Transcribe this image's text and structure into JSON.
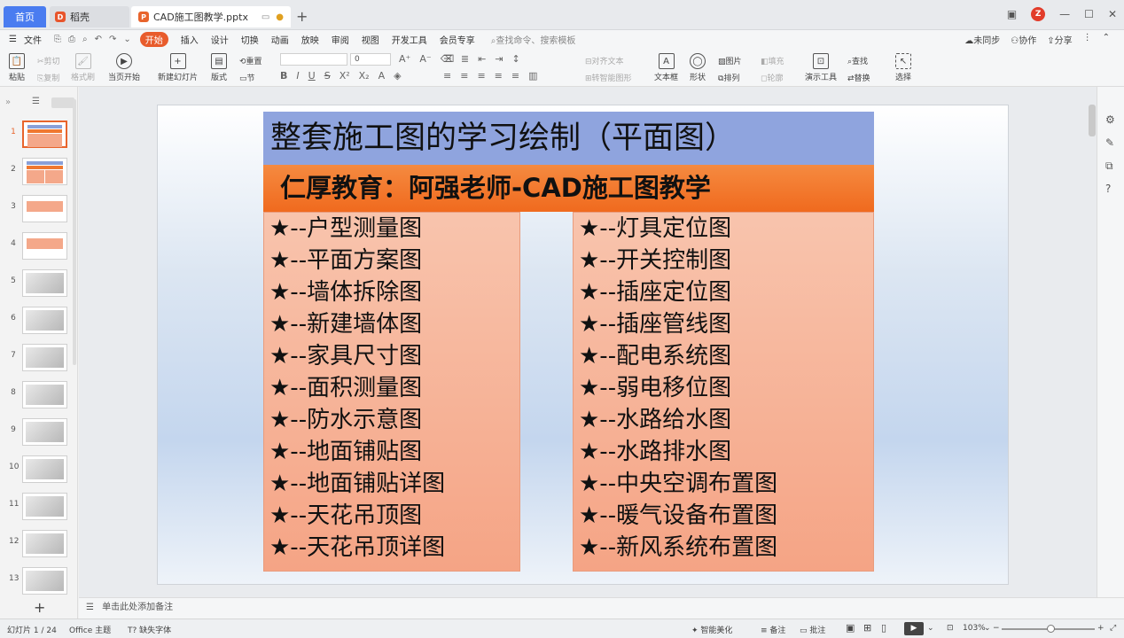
{
  "tabs": {
    "home": "首页",
    "shell": "稻壳",
    "document": "CAD施工图教学.pptx"
  },
  "menu": {
    "file": "文件",
    "items": [
      "开始",
      "插入",
      "设计",
      "切换",
      "动画",
      "放映",
      "审阅",
      "视图",
      "开发工具",
      "会员专享"
    ],
    "search": "查找命令、搜索模板",
    "right": [
      "未同步",
      "协作",
      "分享"
    ]
  },
  "ribbon": {
    "paste": "粘贴",
    "cut": "剪切",
    "copy": "复制",
    "format_painter": "格式刷",
    "from_current": "当页开始",
    "new_slide": "新建幻灯片",
    "layout": "版式",
    "section": "节",
    "reset": "重置",
    "font_size": "0",
    "textbox": "文本框",
    "shape": "形状",
    "picture": "图片",
    "arrange": "排列",
    "fill": "填充",
    "outline": "轮廓",
    "presentation_tools": "演示工具",
    "find": "查找",
    "replace": "替换",
    "select": "选择",
    "align_text": "对齐文本",
    "smartart": "转智能图形"
  },
  "slides_count": 13,
  "selected_slide": 1,
  "slide": {
    "title": "整套施工图的学习绘制（平面图）",
    "subtitle": "仁厚教育：阿强老师-CAD施工图教学",
    "left_items": [
      "★--户型测量图",
      "★--平面方案图",
      "★--墙体拆除图",
      "★--新建墙体图",
      "★--家具尺寸图",
      "★--面积测量图",
      "★--防水示意图",
      "★--地面铺贴图",
      "★--地面铺贴详图",
      "★--天花吊顶图",
      "★--天花吊顶详图"
    ],
    "right_items": [
      "★--灯具定位图",
      "★--开关控制图",
      "★--插座定位图",
      "★--插座管线图",
      "★--配电系统图",
      "★--弱电移位图",
      "★--水路给水图",
      "★--水路排水图",
      "★--中央空调布置图",
      "★--暖气设备布置图",
      "★--新风系统布置图"
    ]
  },
  "notes_placeholder": "单击此处添加备注",
  "status": {
    "slide_info": "幻灯片 1 / 24",
    "theme": "Office 主题",
    "missing_font": "缺失字体",
    "beautify": "智能美化",
    "notes": "备注",
    "comment": "批注",
    "zoom": "103%",
    "zoom_fraction": 0.55
  },
  "colors": {
    "accent": "#e85c2c",
    "title_bg": "#8fa4de",
    "subtitle_bg": "#f06a1e",
    "column_bg": "#f5a485"
  }
}
